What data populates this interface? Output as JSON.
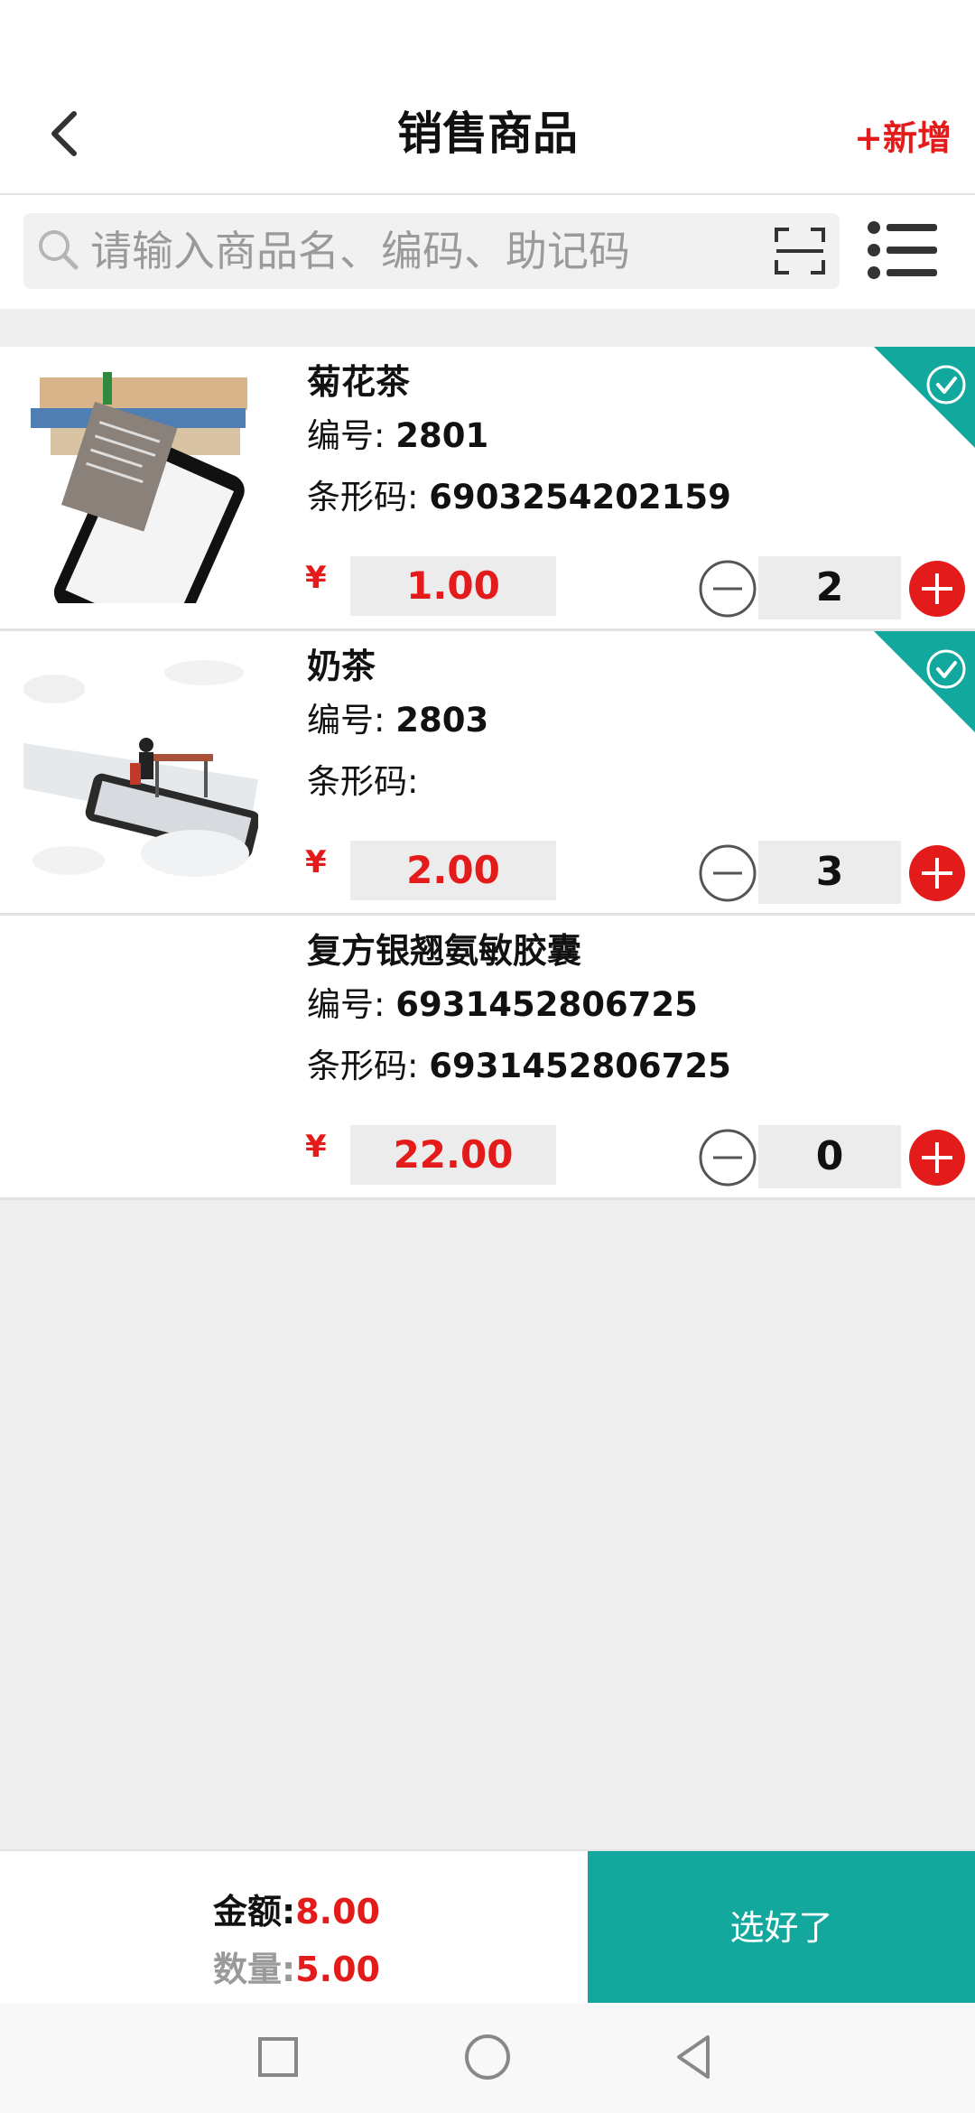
{
  "header": {
    "title": "销售商品",
    "add_label": "+新增"
  },
  "search": {
    "placeholder": "请输入商品名、编码、助记码"
  },
  "products": [
    {
      "name": "菊花茶",
      "code_label": "编号:",
      "code": "2801",
      "barcode_label": "条形码:",
      "barcode": "6903254202159",
      "currency": "¥",
      "price": "1.00",
      "quantity": "2",
      "selected": true
    },
    {
      "name": "奶茶",
      "code_label": "编号:",
      "code": "2803",
      "barcode_label": "条形码:",
      "barcode": "",
      "currency": "¥",
      "price": "2.00",
      "quantity": "3",
      "selected": true
    },
    {
      "name": "复方银翘氨敏胶囊",
      "code_label": "编号:",
      "code": "6931452806725",
      "barcode_label": "条形码:",
      "barcode": "6931452806725",
      "currency": "¥",
      "price": "22.00",
      "quantity": "0",
      "selected": false
    }
  ],
  "summary": {
    "amount_label": "金额:",
    "amount": "8.00",
    "count_label": "数量:",
    "count": "5.00",
    "confirm_label": "选好了"
  },
  "colors": {
    "accent_red": "#e41b1b",
    "accent_teal": "#13a89e"
  },
  "icons": {
    "back": "chevron-left-icon",
    "search": "search-icon",
    "scan": "scan-icon",
    "menu": "list-menu-icon",
    "minus": "minus-circle-icon",
    "plus": "plus-circle-icon",
    "selected": "check-icon"
  }
}
